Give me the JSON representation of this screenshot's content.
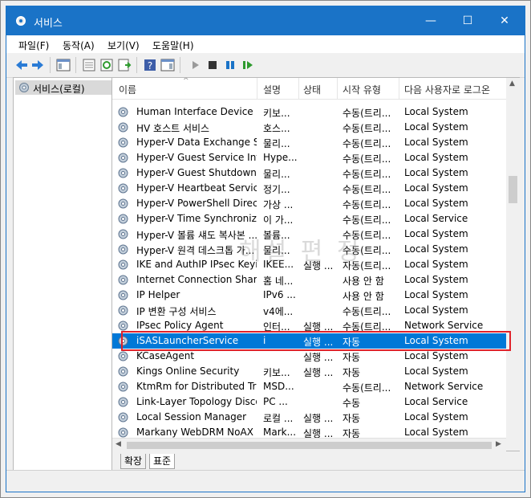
{
  "window": {
    "title": "서비스",
    "minimize": "—",
    "maximize": "☐",
    "close": "✕"
  },
  "menu": [
    "파일(F)",
    "동작(A)",
    "보기(V)",
    "도움말(H)"
  ],
  "tree": {
    "label": "서비스(로컬)"
  },
  "columns": [
    "이름",
    "설명",
    "상태",
    "시작 유형",
    "다음 사용자로 로그온"
  ],
  "rows": [
    {
      "name": "Human Interface Device Se...",
      "desc": "키보...",
      "status": "",
      "startup": "수동(트리...",
      "logon": "Local System"
    },
    {
      "name": "HV 호스트 서비스",
      "desc": "호스...",
      "status": "",
      "startup": "수동(트리...",
      "logon": "Local System"
    },
    {
      "name": "Hyper-V Data Exchange Se...",
      "desc": "물리...",
      "status": "",
      "startup": "수동(트리...",
      "logon": "Local System"
    },
    {
      "name": "Hyper-V Guest Service Inte...",
      "desc": "Hype...",
      "status": "",
      "startup": "수동(트리...",
      "logon": "Local System"
    },
    {
      "name": "Hyper-V Guest Shutdown ...",
      "desc": "물리...",
      "status": "",
      "startup": "수동(트리...",
      "logon": "Local System"
    },
    {
      "name": "Hyper-V Heartbeat Service",
      "desc": "정기...",
      "status": "",
      "startup": "수동(트리...",
      "logon": "Local System"
    },
    {
      "name": "Hyper-V PowerShell Direct...",
      "desc": "가상 ...",
      "status": "",
      "startup": "수동(트리...",
      "logon": "Local System"
    },
    {
      "name": "Hyper-V Time Synchroniza...",
      "desc": "이 가...",
      "status": "",
      "startup": "수동(트리...",
      "logon": "Local Service"
    },
    {
      "name": "Hyper-V 볼륨 섀도 복사본 ...",
      "desc": "볼륨...",
      "status": "",
      "startup": "수동(트리...",
      "logon": "Local System"
    },
    {
      "name": "Hyper-V 원격 데스크톱 가...",
      "desc": "물리...",
      "status": "",
      "startup": "수동(트리...",
      "logon": "Local System"
    },
    {
      "name": "IKE and AuthIP IPsec Keyin...",
      "desc": "IKEE...",
      "status": "실행 ...",
      "startup": "자동(트리...",
      "logon": "Local System"
    },
    {
      "name": "Internet Connection Sharin...",
      "desc": "홈 네...",
      "status": "",
      "startup": "사용 안 함",
      "logon": "Local System"
    },
    {
      "name": "IP Helper",
      "desc": "IPv6 ...",
      "status": "",
      "startup": "사용 안 함",
      "logon": "Local System"
    },
    {
      "name": "IP 변환 구성 서비스",
      "desc": "v4에...",
      "status": "",
      "startup": "수동(트리...",
      "logon": "Local System"
    },
    {
      "name": "IPsec Policy Agent",
      "desc": "인터...",
      "status": "실행 ...",
      "startup": "수동(트리...",
      "logon": "Network Service"
    },
    {
      "name": "iSASLauncherService",
      "desc": "i",
      "status": "실행 ...",
      "startup": "자동",
      "logon": "Local System",
      "selected": true
    },
    {
      "name": "KCaseAgent",
      "desc": "",
      "status": "실행 ...",
      "startup": "자동",
      "logon": "Local System"
    },
    {
      "name": "Kings Online Security",
      "desc": "키보...",
      "status": "실행 ...",
      "startup": "자동",
      "logon": "Local System"
    },
    {
      "name": "KtmRm for Distributed Tra...",
      "desc": "MSD...",
      "status": "",
      "startup": "수동(트리...",
      "logon": "Network Service"
    },
    {
      "name": "Link-Layer Topology Disco...",
      "desc": "PC ...",
      "status": "",
      "startup": "수동",
      "logon": "Local Service"
    },
    {
      "name": "Local Session Manager",
      "desc": "로컬 ...",
      "status": "실행 ...",
      "startup": "자동",
      "logon": "Local System"
    },
    {
      "name": "Markany WebDRM NoAX",
      "desc": "Mark...",
      "status": "실행 ...",
      "startup": "자동",
      "logon": "Local System"
    }
  ],
  "tabs": [
    "확장",
    "표준"
  ],
  "watermark": "해설 편 정"
}
